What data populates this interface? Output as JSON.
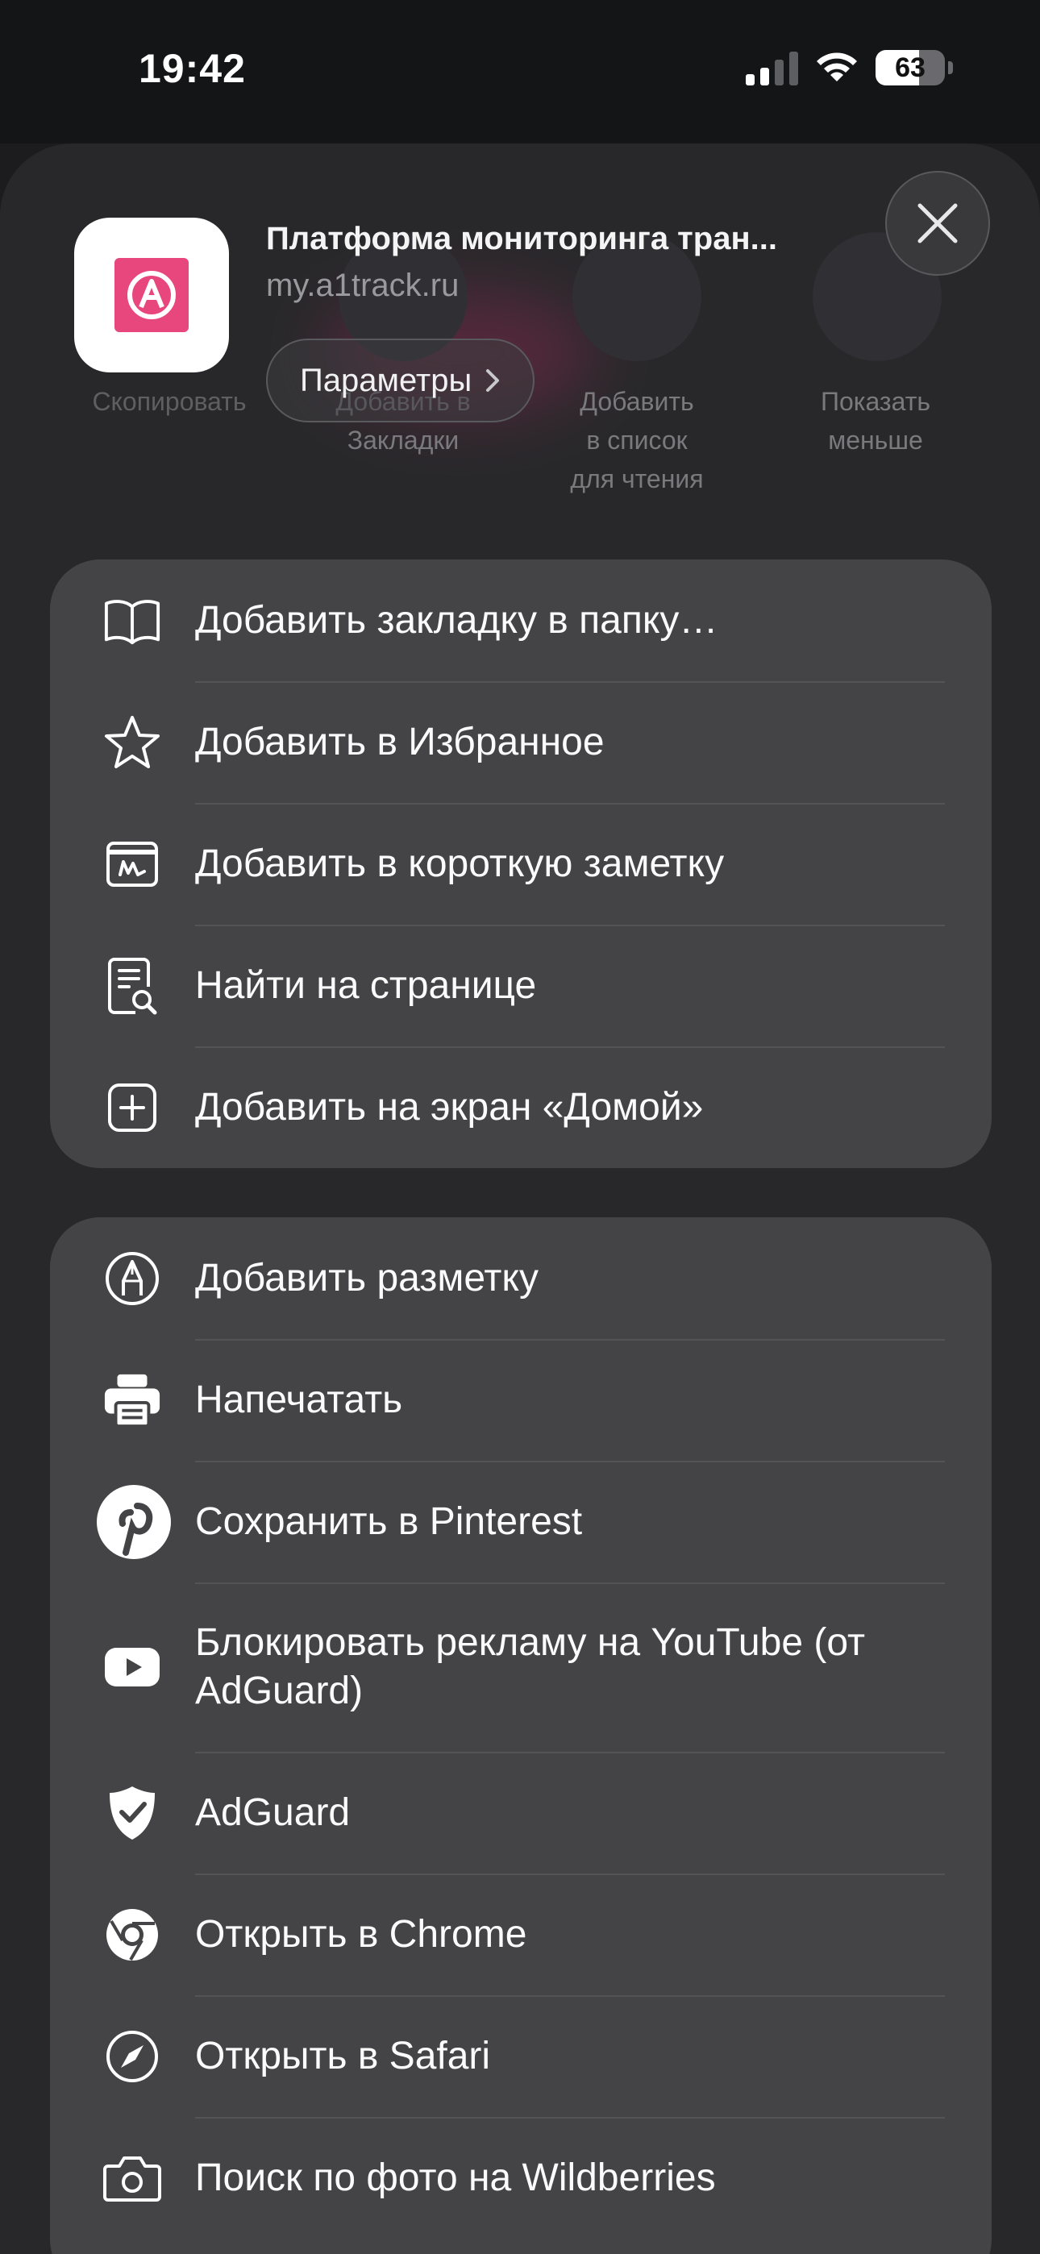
{
  "status_bar": {
    "time": "19:42",
    "battery": "63",
    "battery_level": 0.63
  },
  "background_actions": [
    {
      "label": "Скопировать"
    },
    {
      "label": "Добавить в\nЗакладки"
    },
    {
      "label": "Добавить\nв список\nдля чтения"
    },
    {
      "label": "Показать\nменьше"
    }
  ],
  "share_header": {
    "title": "Платформа мониторинга тран...",
    "url": "my.a1track.ru",
    "params_label": "Параметры"
  },
  "group1": [
    {
      "label": "Добавить закладку в папку…",
      "icon": "book-icon"
    },
    {
      "label": "Добавить в Избранное",
      "icon": "star-icon"
    },
    {
      "label": "Добавить в короткую заметку",
      "icon": "quick-note-icon"
    },
    {
      "label": "Найти на странице",
      "icon": "find-on-page-icon"
    },
    {
      "label": "Добавить на экран «Домой»",
      "icon": "add-square-icon"
    }
  ],
  "group2": [
    {
      "label": "Добавить разметку",
      "icon": "markup-pen-icon"
    },
    {
      "label": "Напечатать",
      "icon": "printer-icon"
    },
    {
      "label": "Сохранить в Pinterest",
      "icon": "pinterest-icon"
    },
    {
      "label": "Блокировать рекламу на YouTube (от AdGuard)",
      "icon": "youtube-icon"
    },
    {
      "label": "AdGuard",
      "icon": "adguard-shield-icon"
    },
    {
      "label": "Открыть в Chrome",
      "icon": "chrome-icon"
    },
    {
      "label": "Открыть в Safari",
      "icon": "safari-compass-icon"
    },
    {
      "label": "Поиск по фото на Wildberries",
      "icon": "camera-icon"
    }
  ]
}
